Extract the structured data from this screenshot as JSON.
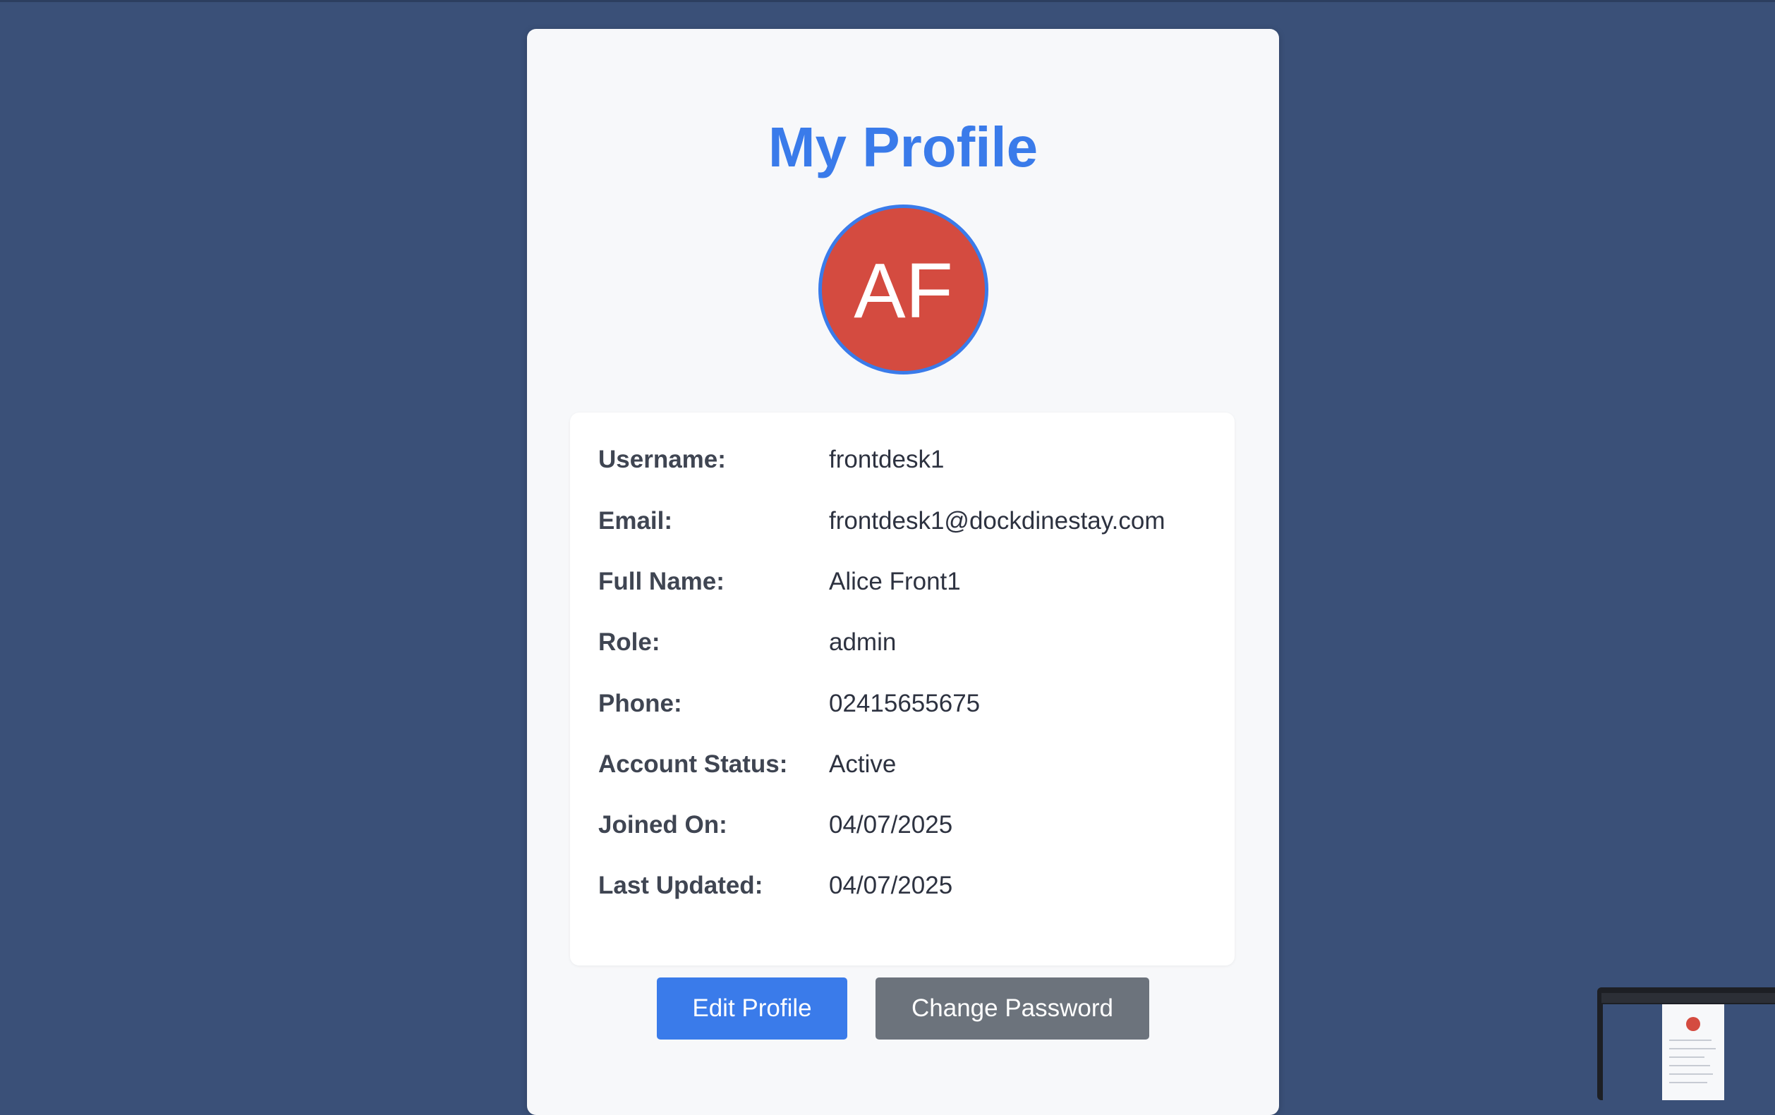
{
  "page": {
    "title": "My Profile"
  },
  "avatar": {
    "initials": "AF"
  },
  "profile": {
    "rows": [
      {
        "label": "Username:",
        "value": "frontdesk1"
      },
      {
        "label": "Email:",
        "value": "frontdesk1@dockdinestay.com"
      },
      {
        "label": "Full Name:",
        "value": "Alice Front1"
      },
      {
        "label": "Role:",
        "value": "admin"
      },
      {
        "label": "Phone:",
        "value": "02415655675"
      },
      {
        "label": "Account Status:",
        "value": "Active"
      },
      {
        "label": "Joined On:",
        "value": "04/07/2025"
      },
      {
        "label": "Last Updated:",
        "value": "04/07/2025"
      }
    ]
  },
  "actions": {
    "edit_label": "Edit Profile",
    "change_password_label": "Change Password"
  },
  "colors": {
    "background": "#3a5078",
    "accent": "#3a7bea",
    "avatar": "#d44b40",
    "secondary_button": "#6c737c"
  }
}
